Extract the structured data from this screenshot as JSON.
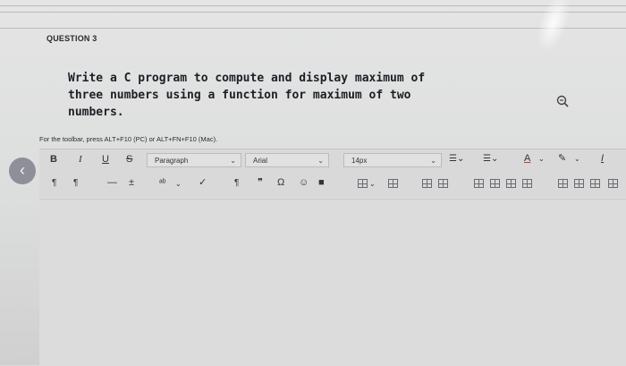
{
  "question": {
    "header": "QUESTION 3",
    "lines": [
      "Write a C program to compute and display maximum of",
      "three numbers using a function for maximum of two",
      "numbers."
    ]
  },
  "toolbar_hint": "For the toolbar, press ALT+F10 (PC) or ALT+FN+F10 (Mac).",
  "toolbar": {
    "bold": "B",
    "italic": "I",
    "underline": "U",
    "strikethrough": "S",
    "paragraph_select": "Paragraph",
    "font_select": "Arial",
    "size_select": "14px",
    "row2_ltr": "¶",
    "row2_rtl": "¶",
    "hr": "—",
    "pilcrow": "¶",
    "quote": "❞",
    "omega": "Ω"
  },
  "colors": {
    "back_button": "#8f8f9a",
    "toolbar_bg": "#d8d9d8",
    "editor_bg": "#dbdcdb"
  }
}
